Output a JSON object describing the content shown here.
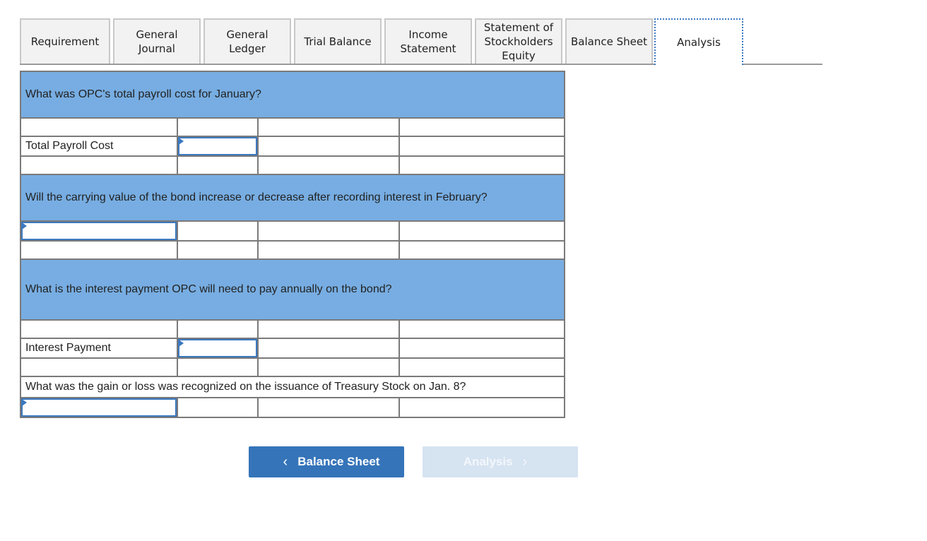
{
  "tabs": [
    {
      "label": "Requirement",
      "active": false
    },
    {
      "label": "General Journal",
      "active": false
    },
    {
      "label": "General Ledger",
      "active": false
    },
    {
      "label": "Trial Balance",
      "active": false
    },
    {
      "label": "Income Statement",
      "active": false
    },
    {
      "label": "Statement of Stockholders Equity",
      "active": false
    },
    {
      "label": "Balance Sheet",
      "active": false
    },
    {
      "label": "Analysis",
      "active": true
    }
  ],
  "questions": {
    "q1": {
      "text": "What was OPC's total payroll cost for January?",
      "row_label": "Total Payroll Cost",
      "value": ""
    },
    "q2": {
      "text": "Will the carrying value of the bond increase or decrease after recording interest in February?",
      "value": ""
    },
    "q3": {
      "text": "What is the interest payment OPC will need to pay annually on the bond?",
      "row_label": "Interest Payment",
      "value": ""
    },
    "q4": {
      "text": "What was the gain or loss was recognized on the issuance of Treasury Stock on Jan. 8?",
      "value": ""
    }
  },
  "nav": {
    "prev_label": "Balance Sheet",
    "prev_icon": "‹",
    "next_label": "Analysis",
    "next_icon": "›",
    "next_disabled": true
  },
  "colors": {
    "question_bg": "#77ade2",
    "accent": "#3574b9",
    "disabled_button": "#d6e3f1"
  }
}
